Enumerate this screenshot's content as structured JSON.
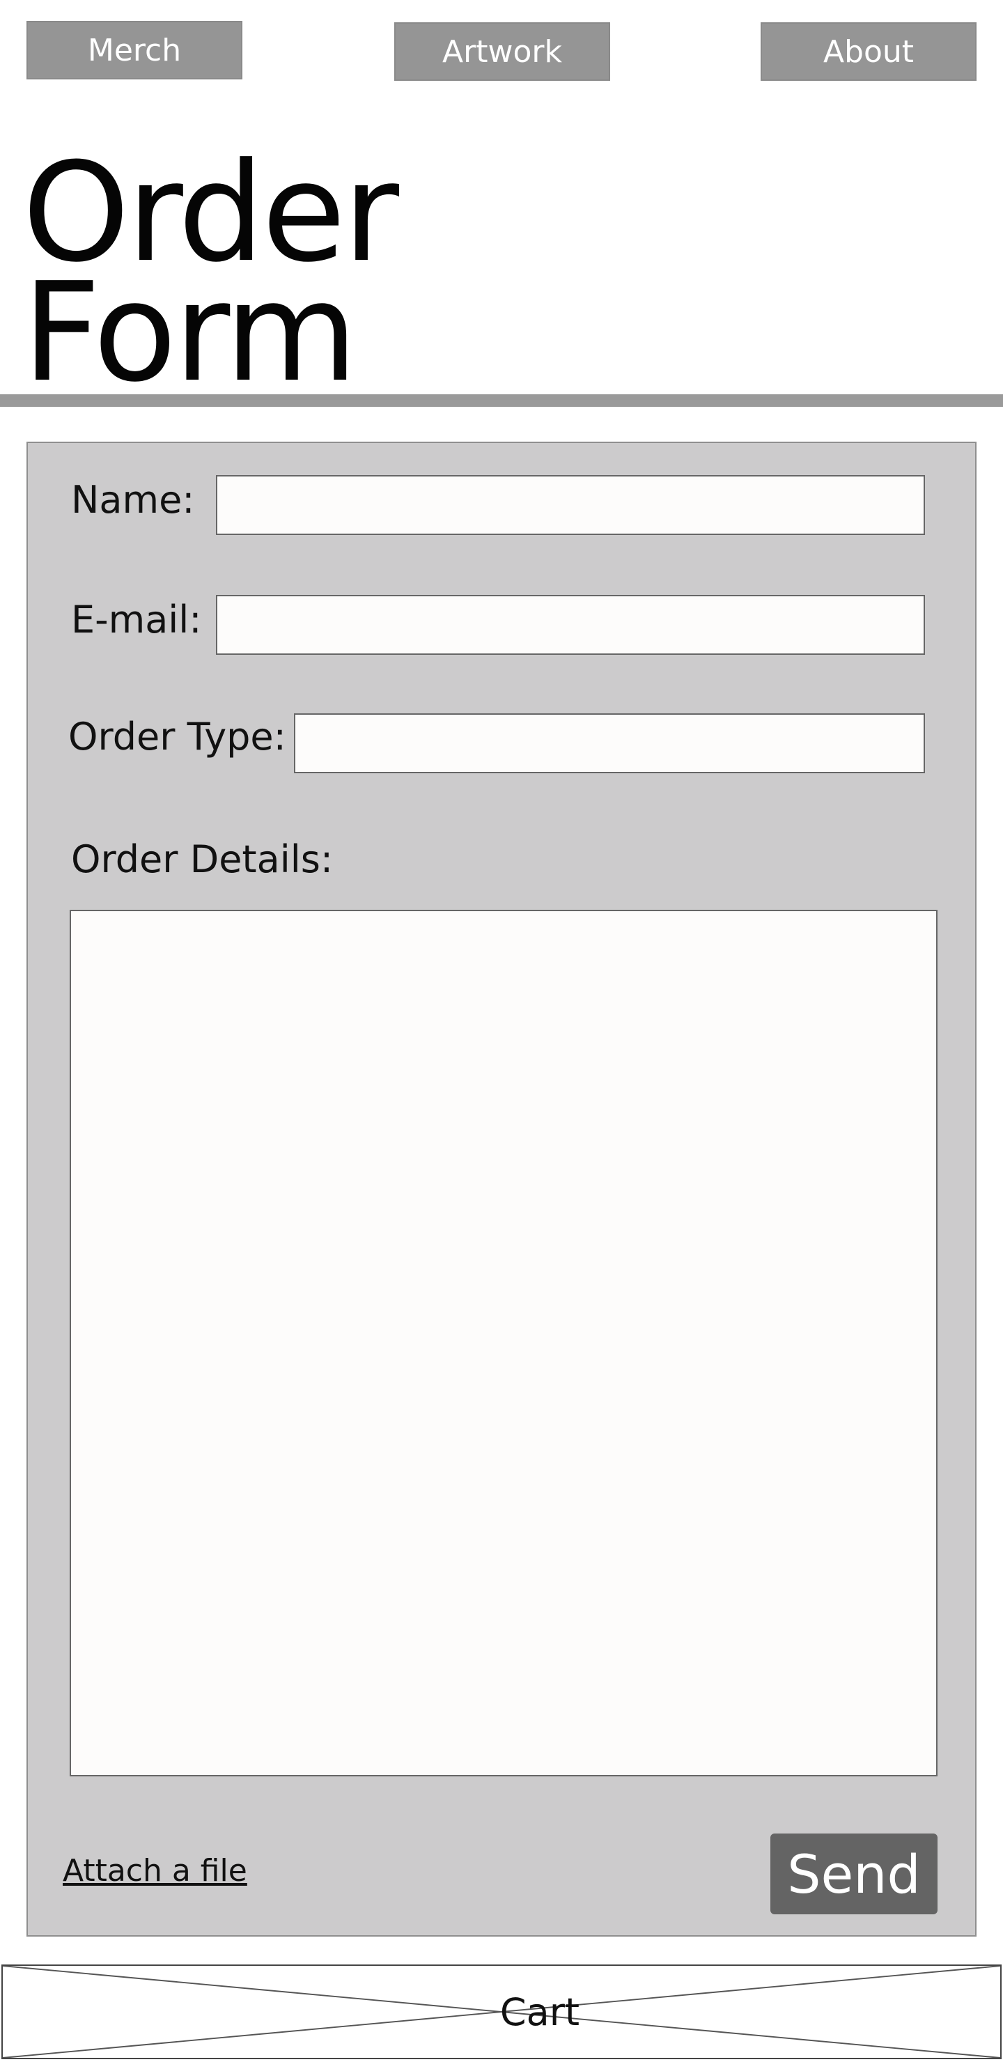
{
  "nav": {
    "merch": "Merch",
    "artwork": "Artwork",
    "about": "About"
  },
  "header": {
    "title_line1": "Order",
    "title_line2": "Form"
  },
  "form": {
    "name_label": "Name:",
    "name_value": "",
    "email_label": "E-mail:",
    "email_value": "",
    "order_type_label": "Order Type:",
    "order_type_value": "",
    "details_label": "Order Details:",
    "details_value": "",
    "attach_label": "Attach a file",
    "send_label": "Send"
  },
  "cart": {
    "label": "Cart"
  },
  "colors": {
    "nav_bg": "#959595",
    "divider": "#9a9a9a",
    "panel_bg": "#cccbcc",
    "input_bg": "#fdfcfb",
    "send_bg": "#646464"
  }
}
